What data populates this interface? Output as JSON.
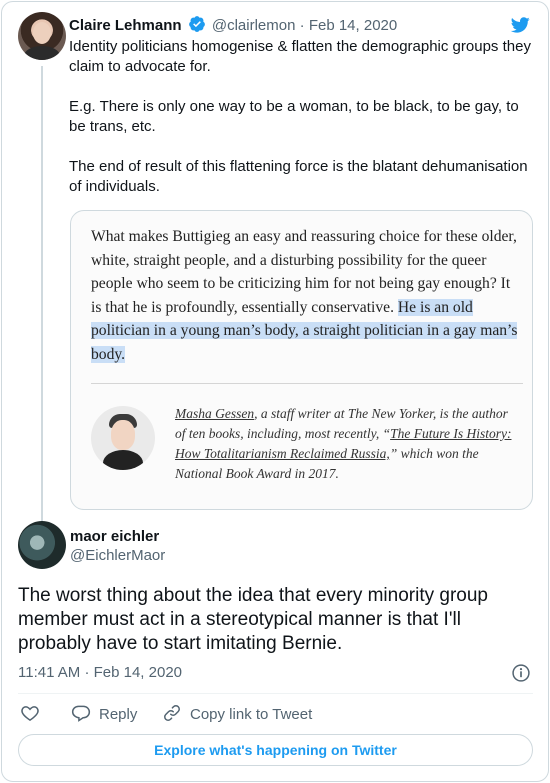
{
  "parent_tweet": {
    "author_name": "Claire Lehmann",
    "handle": "@clairlemon",
    "separator": "·",
    "date": "Feb 14, 2020",
    "paragraphs": [
      "Identity politicians homogenise & flatten the demographic groups they claim to advocate for.",
      "E.g. There is only one way to be a woman, to be black, to be gay, to be trans, etc.",
      "The end of result of this flattening force is the blatant dehumanisation of individuals."
    ],
    "image": {
      "excerpt_plain": "What makes Buttigieg an easy and reassuring choice for these older, white, straight people, and a disturbing possibility for the queer people who seem to be criticizing him for not being gay enough? It is that he is profoundly, essentially conservative. ",
      "excerpt_highlighted": "He is an old politician in a young man’s body, a straight politician in a gay man’s body.",
      "bio_part1": "Masha Gessen",
      "bio_part2": ", a staff writer at The New Yorker, is the author of ten books, including, most recently, “",
      "bio_part3": "The Future Is History: How Totalitarianism Reclaimed Russia,",
      "bio_part4": "” which won the National Book Award in 2017."
    }
  },
  "main_tweet": {
    "author_name": "maor eichler",
    "handle": "@EichlerMaor",
    "text": "The worst thing about the idea that every minority group member must act in a stereotypical manner is that I'll probably have to start imitating Bernie.",
    "time": "11:41 AM",
    "separator": "·",
    "date": "Feb 14, 2020"
  },
  "actions": {
    "reply_label": "Reply",
    "copy_label": "Copy link to Tweet"
  },
  "explore_label": "Explore what's happening on Twitter",
  "colors": {
    "accent": "#1d9bf0",
    "secondary_text": "#536471",
    "highlight": "#c9def6"
  },
  "icons": [
    "verified-badge-icon",
    "twitter-bird-icon",
    "info-icon",
    "heart-icon",
    "reply-icon",
    "link-icon"
  ]
}
